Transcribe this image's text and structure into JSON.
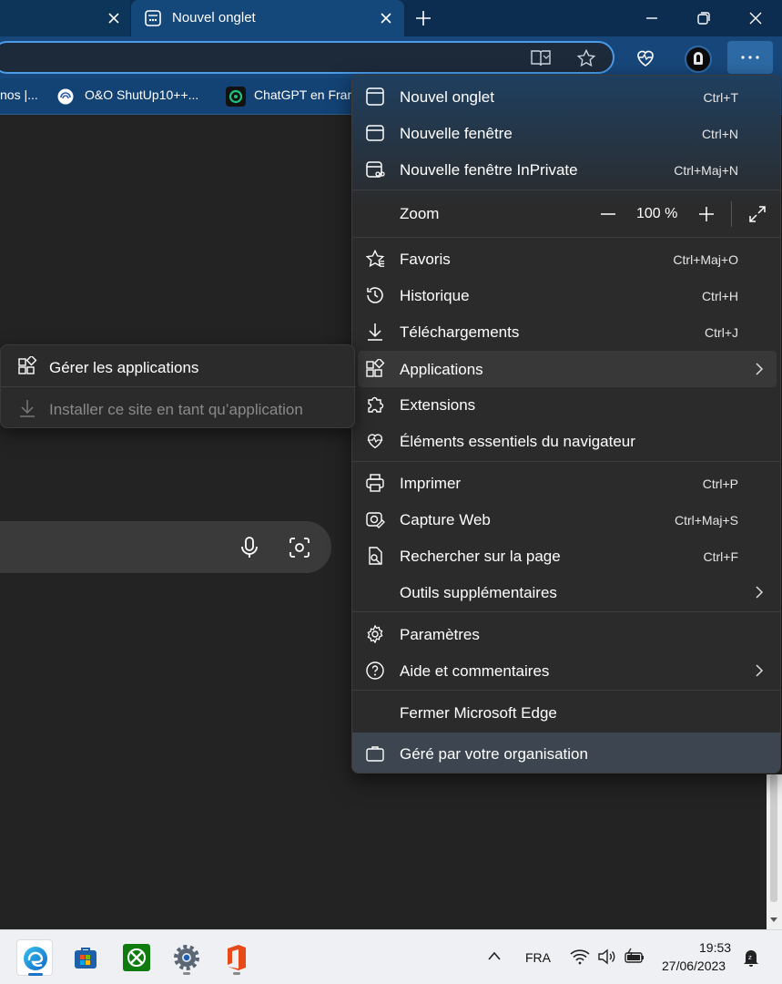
{
  "browser": {
    "tabs": [
      {
        "title": ""
      },
      {
        "title": "Nouvel onglet"
      }
    ],
    "favorites": [
      {
        "label": "nos |..."
      },
      {
        "label": "O&O ShutUp10++..."
      },
      {
        "label": "ChatGPT en Fran"
      }
    ]
  },
  "menu": {
    "items": [
      {
        "label": "Nouvel onglet",
        "shortcut": "Ctrl+T",
        "icon": "new-tab-icon"
      },
      {
        "label": "Nouvelle fenêtre",
        "shortcut": "Ctrl+N",
        "icon": "new-window-icon"
      },
      {
        "label": "Nouvelle fenêtre InPrivate",
        "shortcut": "Ctrl+Maj+N",
        "icon": "inprivate-icon"
      },
      {
        "label": "Favoris",
        "shortcut": "Ctrl+Maj+O",
        "icon": "favorites-star-icon"
      },
      {
        "label": "Historique",
        "shortcut": "Ctrl+H",
        "icon": "history-icon"
      },
      {
        "label": "Téléchargements",
        "shortcut": "Ctrl+J",
        "icon": "download-icon"
      },
      {
        "label": "Applications",
        "shortcut": "",
        "icon": "apps-icon"
      },
      {
        "label": "Extensions",
        "shortcut": "",
        "icon": "extensions-puzzle-icon"
      },
      {
        "label": "Éléments essentiels du navigateur",
        "shortcut": "",
        "icon": "heartbeat-icon"
      },
      {
        "label": "Imprimer",
        "shortcut": "Ctrl+P",
        "icon": "printer-icon"
      },
      {
        "label": "Capture Web",
        "shortcut": "Ctrl+Maj+S",
        "icon": "web-capture-icon"
      },
      {
        "label": "Rechercher sur la page",
        "shortcut": "Ctrl+F",
        "icon": "find-on-page-icon"
      },
      {
        "label": "Outils supplémentaires",
        "shortcut": "",
        "icon": ""
      },
      {
        "label": "Paramètres",
        "shortcut": "",
        "icon": "gear-icon"
      },
      {
        "label": "Aide et commentaires",
        "shortcut": "",
        "icon": "help-icon"
      },
      {
        "label": "Fermer Microsoft Edge",
        "shortcut": "",
        "icon": ""
      },
      {
        "label": "Géré par votre organisation",
        "shortcut": "",
        "icon": "briefcase-icon"
      }
    ],
    "zoom": {
      "label": "Zoom",
      "value": "100 %"
    }
  },
  "submenu": {
    "items": [
      {
        "label": "Gérer les applications",
        "enabled": true
      },
      {
        "label": "Installer ce site en tant qu’application",
        "enabled": false
      }
    ]
  },
  "taskbar": {
    "language": "FRA",
    "time": "19:53",
    "date": "27/06/2023"
  },
  "colors": {
    "accent": "#4a9be8",
    "menu_bg": "#2b2b2b",
    "taskbar_bg": "#eef0f3"
  }
}
